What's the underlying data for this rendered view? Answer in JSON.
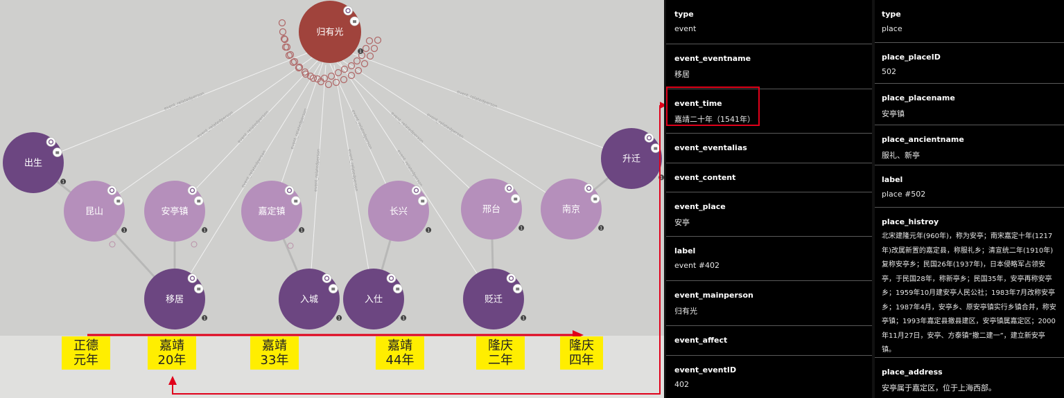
{
  "graph": {
    "center": {
      "label": "归有光",
      "color": "#a0433c"
    },
    "events": [
      "出生",
      "移居",
      "入城",
      "入仕",
      "贬迁",
      "升迁"
    ],
    "places": [
      "昆山",
      "安亭镇",
      "嘉定镇",
      "长兴",
      "邢台",
      "南京"
    ],
    "event_color": "#6c4681",
    "place_color": "#b58fbb",
    "edge_label": "event_relatedperson",
    "badge_count": "1"
  },
  "timeline": {
    "labels": [
      {
        "l1": "正德",
        "l2": "元年"
      },
      {
        "l1": "嘉靖",
        "l2": "20年"
      },
      {
        "l1": "嘉靖",
        "l2": "33年"
      },
      {
        "l1": "嘉靖",
        "l2": "44年"
      },
      {
        "l1": "隆庆",
        "l2": "二年"
      },
      {
        "l1": "隆庆",
        "l2": "四年"
      }
    ],
    "highlight_color": "#ffee00",
    "arrow_color": "#e0001a"
  },
  "event_panel": {
    "fields": [
      {
        "key": "type",
        "value": "event"
      },
      {
        "key": "event_eventname",
        "value": "移居"
      },
      {
        "key": "event_time",
        "value": "嘉靖二十年（1541年）"
      },
      {
        "key": "event_eventalias",
        "value": ""
      },
      {
        "key": "event_content",
        "value": ""
      },
      {
        "key": "event_place",
        "value": "安亭"
      },
      {
        "key": "label",
        "value": "event #402"
      },
      {
        "key": "event_mainperson",
        "value": "归有光"
      },
      {
        "key": "event_affect",
        "value": ""
      },
      {
        "key": "event_eventID",
        "value": "402"
      }
    ]
  },
  "place_panel": {
    "fields": [
      {
        "key": "type",
        "value": "place"
      },
      {
        "key": "place_placeID",
        "value": "502"
      },
      {
        "key": "place_placename",
        "value": "安亭镇"
      },
      {
        "key": "place_ancientname",
        "value": "服礼、新亭"
      },
      {
        "key": "label",
        "value": "place #502"
      },
      {
        "key": "place_histroy",
        "value": "北宋建隆元年(960年)，称为安亭；南宋嘉定十年(1217年)改属新置的嘉定县，称服礼乡；清宣统二年(1910年)复称安亭乡；民国26年(1937年)，日本侵略军占领安亭，于民国28年，称新亭乡；民国35年，安亭再称安亭乡；1959年10月建安亭人民公社；1983年7月改称安亭乡；1987年4月，安亭乡、原安亭镇实行乡镇合并，称安亭镇；1993年嘉定县撤县建区，安亭镇属嘉定区；2000年11月27日，安亭、方泰镇“撤二建一”，建立新安亭镇。"
      },
      {
        "key": "place_address",
        "value": "安亭属于嘉定区，位于上海西部。"
      }
    ]
  }
}
